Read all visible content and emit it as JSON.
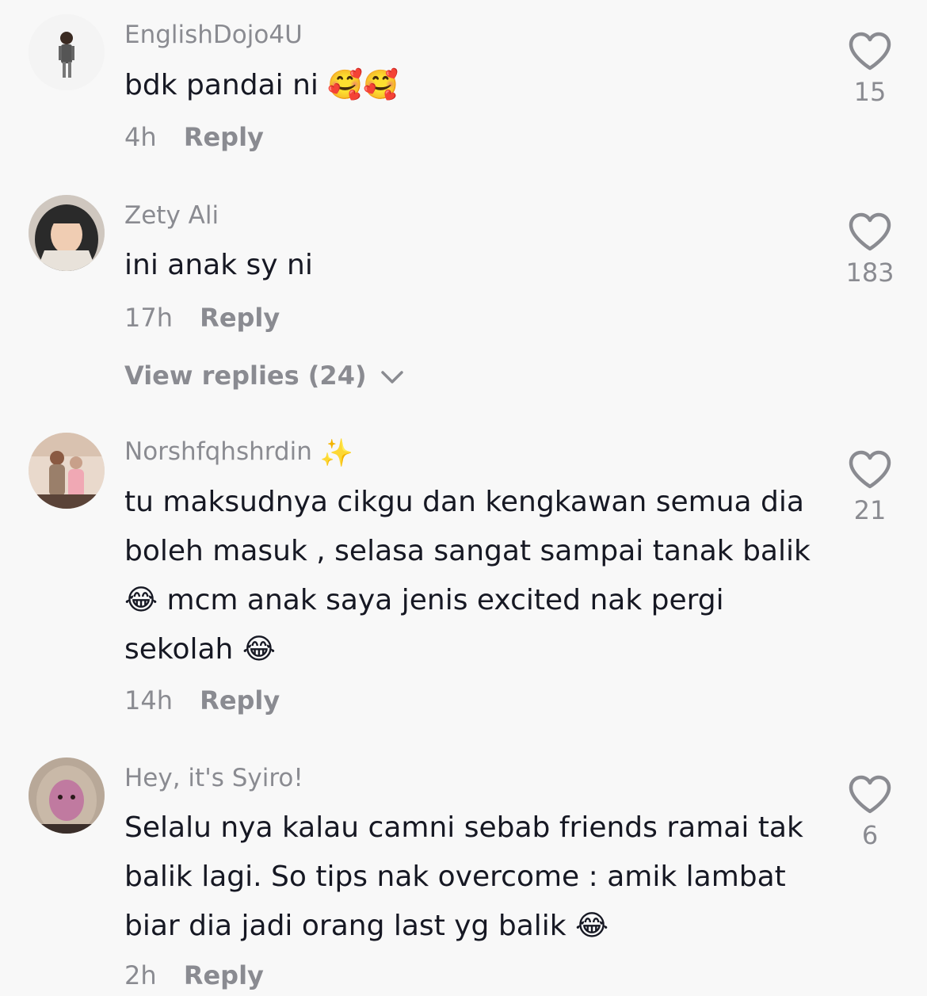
{
  "comments": [
    {
      "username": "EnglishDojo4U",
      "text": "bdk pandai ni 🥰🥰",
      "time": "4h",
      "reply_label": "Reply",
      "likes": "15",
      "avatar": "user-avatar-man-standing"
    },
    {
      "username": "Zety Ali",
      "text": "ini anak sy ni",
      "time": "17h",
      "reply_label": "Reply",
      "likes": "183",
      "view_replies": "View replies (24)",
      "avatar": "user-avatar-woman-headscarf"
    },
    {
      "username": "Norshfqhshrdin",
      "username_suffix": "✨",
      "text": "tu maksudnya cikgu dan kengkawan semua dia boleh masuk , selasa sangat sampai tanak balik 😂 mcm anak saya jenis excited nak pergi sekolah 😂",
      "time": "14h",
      "reply_label": "Reply",
      "likes": "21",
      "avatar": "user-avatar-couple-photo"
    },
    {
      "username": "Hey, it's Syiro!",
      "text": "Selalu nya kalau camni sebab friends ramai tak balik lagi. So tips nak overcome : amik lambat biar dia jadi orang last yg balik 😂",
      "time": "2h",
      "reply_label": "Reply",
      "likes": "6",
      "avatar": "user-avatar-woman-face-mask"
    }
  ],
  "icons": {
    "like": "heart-outline-icon",
    "expand": "chevron-down-icon"
  },
  "colors": {
    "background": "#f8f8f8",
    "primary_text": "#161823",
    "secondary_text": "#8a8b91"
  }
}
